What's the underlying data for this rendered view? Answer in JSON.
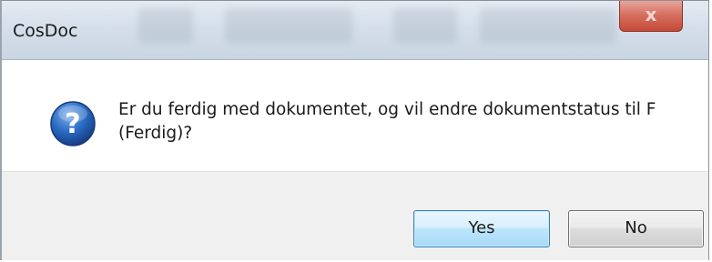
{
  "window": {
    "title": "CosDoc",
    "close_glyph": "x"
  },
  "dialog": {
    "icon": "question-icon",
    "message_line1": "Er du ferdig med dokumentet, og vil endre dokumentstatus til F",
    "message_line2": "(Ferdig)?"
  },
  "buttons": {
    "yes_label": "Yes",
    "no_label": "No"
  },
  "colors": {
    "icon_blue": "#2a6cc4",
    "primary_button_border": "#3c7fb1",
    "close_button_red": "#d56d5c",
    "footer_bg": "#f0f0f0"
  }
}
